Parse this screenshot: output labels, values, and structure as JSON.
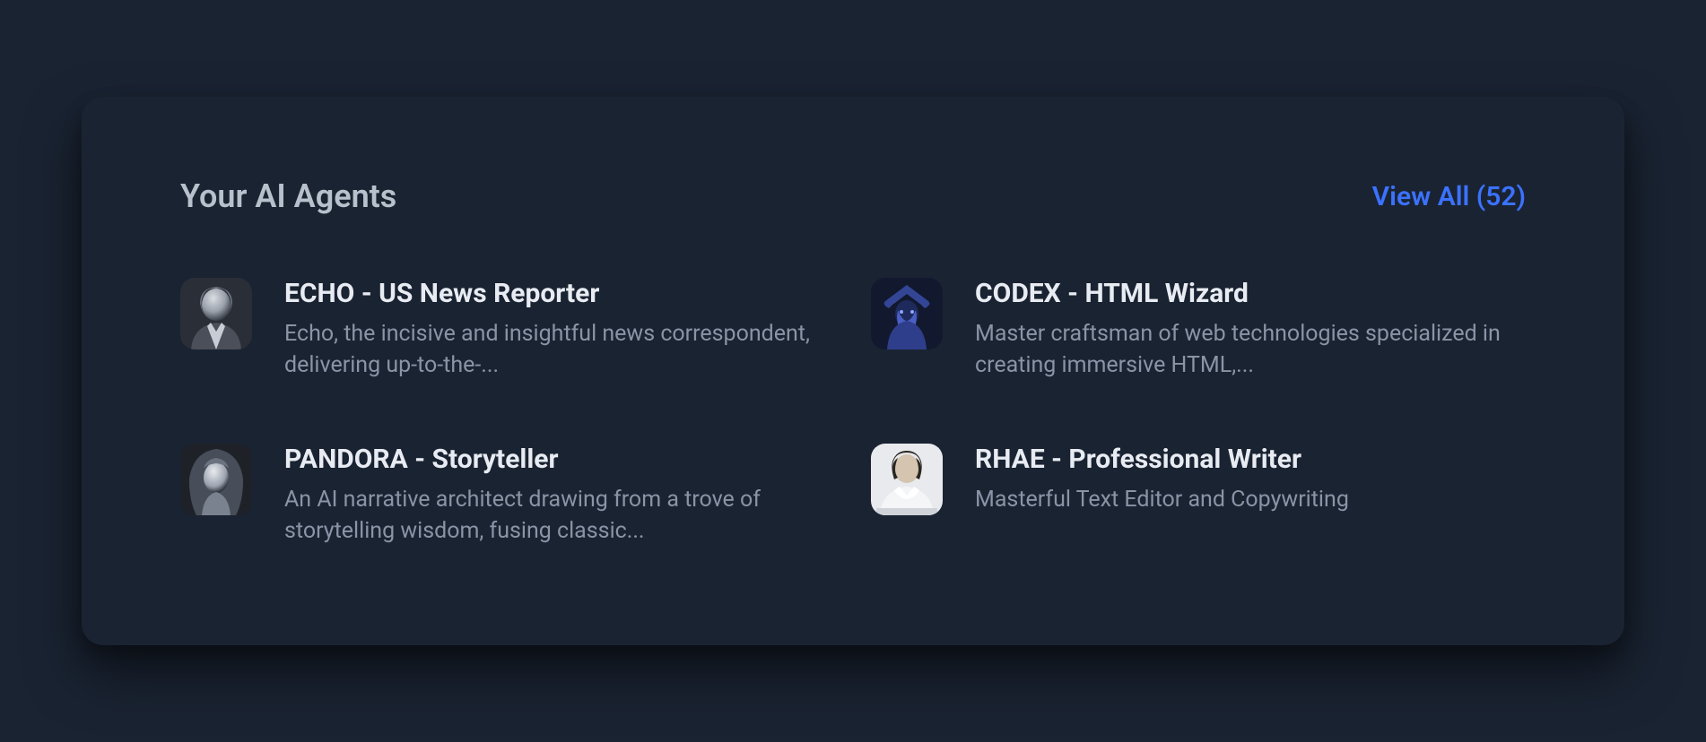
{
  "header": {
    "title": "Your AI Agents",
    "view_all_label": "View All (52)"
  },
  "agents": [
    {
      "name": "ECHO - US News Reporter",
      "description": "Echo, the incisive and insightful news correspondent, delivering up-to-the-...",
      "avatar_icon": "woman-reporter"
    },
    {
      "name": "CODEX - HTML Wizard",
      "description": "Master craftsman of web technologies specialized in creating immersive HTML,...",
      "avatar_icon": "wizard"
    },
    {
      "name": "PANDORA - Storyteller",
      "description": "An AI narrative architect drawing from a trove of storytelling wisdom, fusing classic...",
      "avatar_icon": "hooded-woman"
    },
    {
      "name": "RHAE - Professional Writer",
      "description": "Masterful Text Editor and Copywriting",
      "avatar_icon": "professional-woman"
    }
  ]
}
